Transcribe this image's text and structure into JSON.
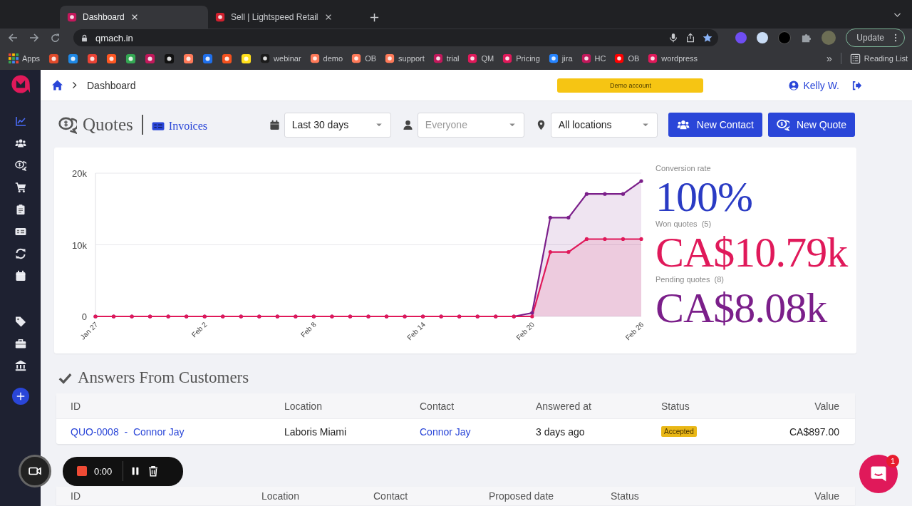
{
  "browser": {
    "tabs": [
      {
        "title": "Dashboard",
        "selected": true,
        "color": "#c2185b"
      },
      {
        "title": "Sell | Lightspeed Retail",
        "selected": false,
        "color": "#d0202e"
      }
    ],
    "url": "qmach.in",
    "update_button": "Update",
    "bookmarks": [
      {
        "kind": "apps",
        "label": "Apps"
      },
      {
        "kind": "icon",
        "color": "#e04a2a"
      },
      {
        "kind": "icon",
        "color": "#1e88e5"
      },
      {
        "kind": "icon",
        "color": "#ea4335"
      },
      {
        "kind": "icon",
        "color": "#ff5722"
      },
      {
        "kind": "icon",
        "color": "#34a853"
      },
      {
        "kind": "icon",
        "color": "#c2185b"
      },
      {
        "kind": "icon",
        "color": "#111111"
      },
      {
        "kind": "icon",
        "color": "#ff7a59"
      },
      {
        "kind": "icon",
        "color": "#1f6feb"
      },
      {
        "kind": "icon",
        "color": "#f4511e"
      },
      {
        "kind": "icon",
        "color": "#ffe01b"
      },
      {
        "kind": "labeled",
        "label": "webinar",
        "color": "#1b1b1b"
      },
      {
        "kind": "labeled",
        "label": "demo",
        "color": "#ff7a59"
      },
      {
        "kind": "labeled",
        "label": "OB",
        "color": "#ff7a59"
      },
      {
        "kind": "labeled",
        "label": "support",
        "color": "#ff7a59"
      },
      {
        "kind": "labeled",
        "label": "trial",
        "color": "#c2185b"
      },
      {
        "kind": "labeled",
        "label": "QM",
        "color": "#e0195a"
      },
      {
        "kind": "labeled",
        "label": "Pricing",
        "color": "#e0195a"
      },
      {
        "kind": "labeled",
        "label": "jira",
        "color": "#2684ff"
      },
      {
        "kind": "labeled",
        "label": "HC",
        "color": "#c2185b"
      },
      {
        "kind": "labeled",
        "label": "OB",
        "color": "#ff0000"
      },
      {
        "kind": "labeled",
        "label": "wordpress",
        "color": "#e0195a"
      }
    ],
    "overflow": "»",
    "reading_list": "Reading List"
  },
  "sidebar": {
    "items": [
      {
        "kind": "chart",
        "selected": true
      },
      {
        "kind": "users",
        "selected": false
      },
      {
        "kind": "bubbles",
        "selected": false
      },
      {
        "kind": "cart",
        "selected": false
      },
      {
        "kind": "clipboard",
        "selected": false
      },
      {
        "kind": "card",
        "selected": false
      },
      {
        "kind": "refresh",
        "selected": false
      },
      {
        "kind": "calendar",
        "selected": false
      },
      {
        "kind": "tag",
        "selected": false
      },
      {
        "kind": "toolbox",
        "selected": false
      },
      {
        "kind": "bank",
        "selected": false
      }
    ]
  },
  "header": {
    "breadcrumb": "Dashboard",
    "demo_badge": "Demo account",
    "user": "Kelly W."
  },
  "toolbar": {
    "title": "Quotes",
    "invoices_link": "Invoices",
    "filters": [
      {
        "kind": "calendar",
        "value": "Last 30 days"
      },
      {
        "kind": "person",
        "placeholder": "Everyone"
      },
      {
        "kind": "pin",
        "value": "All locations"
      }
    ],
    "buttons": [
      {
        "kind": "users",
        "label": "New Contact"
      },
      {
        "kind": "bubbles",
        "label": "New Quote"
      }
    ]
  },
  "chart_data": {
    "type": "area",
    "categories": [
      "Jan 27",
      null,
      null,
      null,
      null,
      null,
      "Feb 2",
      null,
      null,
      null,
      null,
      null,
      "Feb 8",
      null,
      null,
      null,
      null,
      null,
      "Feb 14",
      null,
      null,
      null,
      null,
      null,
      "Feb 20",
      null,
      null,
      null,
      null,
      null,
      "Feb 26"
    ],
    "ylim": [
      0,
      20000
    ],
    "yticks": [
      {
        "value": 0,
        "label": "0"
      },
      {
        "value": 10000,
        "label": "10k"
      },
      {
        "value": 20000,
        "label": "20k"
      }
    ],
    "series": [
      {
        "color": "#7b1f8a",
        "values": [
          0,
          0,
          0,
          0,
          0,
          0,
          0,
          0,
          0,
          0,
          0,
          0,
          0,
          0,
          0,
          0,
          0,
          0,
          0,
          0,
          0,
          0,
          0,
          0,
          500,
          13800,
          13800,
          17100,
          17100,
          17100,
          18900
        ]
      },
      {
        "color": "#e0195a",
        "values": [
          0,
          0,
          0,
          0,
          0,
          0,
          0,
          0,
          0,
          0,
          0,
          0,
          0,
          0,
          0,
          0,
          0,
          0,
          0,
          0,
          0,
          0,
          0,
          0,
          0,
          9000,
          9000,
          10800,
          10800,
          10800,
          10800
        ]
      }
    ]
  },
  "stats": [
    {
      "label": "Conversion rate",
      "value": "100%",
      "color": "#2a3bc4"
    },
    {
      "label": "Won quotes",
      "count": "(5)",
      "value": "CA$10.79k",
      "color": "#e0195a"
    },
    {
      "label": "Pending quotes",
      "count": "(8)",
      "value": "CA$8.08k",
      "color": "#7b1f8a"
    }
  ],
  "answers": {
    "title": "Answers From Customers",
    "columns": [
      "ID",
      "Location",
      "Contact",
      "Answered at",
      "Status",
      "Value"
    ],
    "rows": [
      {
        "id": "QUO-0008  -  Connor Jay",
        "location": "Laboris Miami",
        "contact": "Connor Jay",
        "answered_at": "3 days ago",
        "status": "Accepted",
        "value": "CA$897.00"
      }
    ]
  },
  "proposals": {
    "columns": [
      "ID",
      "Location",
      "Contact",
      "Proposed date",
      "Status",
      "Value"
    ]
  },
  "recorder": {
    "time": "0:00"
  },
  "chat": {
    "badge": "1"
  }
}
